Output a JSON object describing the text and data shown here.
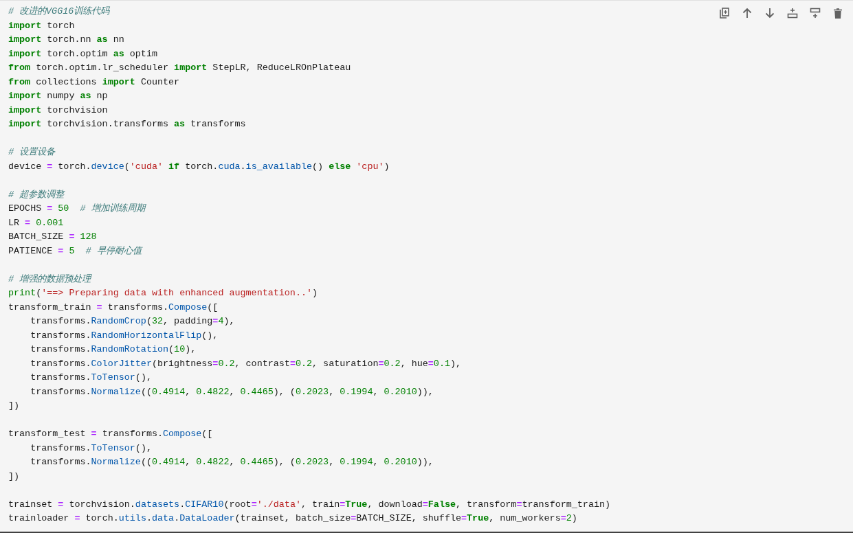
{
  "toolbar": [
    {
      "kind": "duplicate"
    },
    {
      "kind": "move-up"
    },
    {
      "kind": "move-down"
    },
    {
      "kind": "insert-above"
    },
    {
      "kind": "insert-below"
    },
    {
      "kind": "delete"
    }
  ],
  "lines": [
    {
      "kind": "code",
      "tokens": [
        {
          "kind": "comment",
          "text": "# 改进的VGG16训练代码"
        }
      ]
    },
    {
      "kind": "code",
      "tokens": [
        {
          "kind": "keyword",
          "text": "import"
        },
        {
          "kind": "plain",
          "text": " torch"
        }
      ]
    },
    {
      "kind": "code",
      "tokens": [
        {
          "kind": "keyword",
          "text": "import"
        },
        {
          "kind": "plain",
          "text": " torch.nn "
        },
        {
          "kind": "keyword",
          "text": "as"
        },
        {
          "kind": "plain",
          "text": " nn"
        }
      ]
    },
    {
      "kind": "code",
      "tokens": [
        {
          "kind": "keyword",
          "text": "import"
        },
        {
          "kind": "plain",
          "text": " torch.optim "
        },
        {
          "kind": "keyword",
          "text": "as"
        },
        {
          "kind": "plain",
          "text": " optim"
        }
      ]
    },
    {
      "kind": "code",
      "tokens": [
        {
          "kind": "keyword",
          "text": "from"
        },
        {
          "kind": "plain",
          "text": " torch.optim.lr_scheduler "
        },
        {
          "kind": "keyword",
          "text": "import"
        },
        {
          "kind": "plain",
          "text": " StepLR, ReduceLROnPlateau"
        }
      ]
    },
    {
      "kind": "code",
      "tokens": [
        {
          "kind": "keyword",
          "text": "from"
        },
        {
          "kind": "plain",
          "text": " collections "
        },
        {
          "kind": "keyword",
          "text": "import"
        },
        {
          "kind": "plain",
          "text": " Counter"
        }
      ]
    },
    {
      "kind": "code",
      "tokens": [
        {
          "kind": "keyword",
          "text": "import"
        },
        {
          "kind": "plain",
          "text": " numpy "
        },
        {
          "kind": "keyword",
          "text": "as"
        },
        {
          "kind": "plain",
          "text": " np"
        }
      ]
    },
    {
      "kind": "code",
      "tokens": [
        {
          "kind": "keyword",
          "text": "import"
        },
        {
          "kind": "plain",
          "text": " torchvision"
        }
      ]
    },
    {
      "kind": "code",
      "tokens": [
        {
          "kind": "keyword",
          "text": "import"
        },
        {
          "kind": "plain",
          "text": " torchvision.transforms "
        },
        {
          "kind": "keyword",
          "text": "as"
        },
        {
          "kind": "plain",
          "text": " transforms"
        }
      ]
    },
    {
      "kind": "blank"
    },
    {
      "kind": "code",
      "tokens": [
        {
          "kind": "comment",
          "text": "# 设置设备"
        }
      ]
    },
    {
      "kind": "code",
      "tokens": [
        {
          "kind": "plain",
          "text": "device "
        },
        {
          "kind": "operator",
          "text": "="
        },
        {
          "kind": "plain",
          "text": " torch."
        },
        {
          "kind": "property",
          "text": "device"
        },
        {
          "kind": "plain",
          "text": "("
        },
        {
          "kind": "string",
          "text": "'cuda'"
        },
        {
          "kind": "keyword",
          "text": " if"
        },
        {
          "kind": "plain",
          "text": " torch."
        },
        {
          "kind": "property",
          "text": "cuda"
        },
        {
          "kind": "plain",
          "text": "."
        },
        {
          "kind": "property",
          "text": "is_available"
        },
        {
          "kind": "plain",
          "text": "() "
        },
        {
          "kind": "keyword",
          "text": "else"
        },
        {
          "kind": "string",
          "text": " 'cpu'"
        },
        {
          "kind": "plain",
          "text": ")"
        }
      ]
    },
    {
      "kind": "blank"
    },
    {
      "kind": "code",
      "tokens": [
        {
          "kind": "comment",
          "text": "# 超参数调整"
        }
      ]
    },
    {
      "kind": "code",
      "tokens": [
        {
          "kind": "plain",
          "text": "EPOCHS "
        },
        {
          "kind": "operator",
          "text": "="
        },
        {
          "kind": "number",
          "text": " 50"
        },
        {
          "kind": "comment",
          "text": "  # 增加训练周期"
        }
      ]
    },
    {
      "kind": "code",
      "tokens": [
        {
          "kind": "plain",
          "text": "LR "
        },
        {
          "kind": "operator",
          "text": "="
        },
        {
          "kind": "number",
          "text": " 0.001"
        }
      ]
    },
    {
      "kind": "code",
      "tokens": [
        {
          "kind": "plain",
          "text": "BATCH_SIZE "
        },
        {
          "kind": "operator",
          "text": "="
        },
        {
          "kind": "number",
          "text": " 128"
        }
      ]
    },
    {
      "kind": "code",
      "tokens": [
        {
          "kind": "plain",
          "text": "PATIENCE "
        },
        {
          "kind": "operator",
          "text": "="
        },
        {
          "kind": "number",
          "text": " 5"
        },
        {
          "kind": "comment",
          "text": "  # 早停耐心值"
        }
      ]
    },
    {
      "kind": "blank"
    },
    {
      "kind": "code",
      "tokens": [
        {
          "kind": "comment",
          "text": "# 增强的数据预处理"
        }
      ]
    },
    {
      "kind": "code",
      "tokens": [
        {
          "kind": "builtin",
          "text": "print"
        },
        {
          "kind": "plain",
          "text": "("
        },
        {
          "kind": "string",
          "text": "'==> Preparing data with enhanced augmentation..'"
        },
        {
          "kind": "plain",
          "text": ")"
        }
      ]
    },
    {
      "kind": "code",
      "tokens": [
        {
          "kind": "plain",
          "text": "transform_train "
        },
        {
          "kind": "operator",
          "text": "="
        },
        {
          "kind": "plain",
          "text": " transforms."
        },
        {
          "kind": "property",
          "text": "Compose"
        },
        {
          "kind": "plain",
          "text": "(["
        }
      ]
    },
    {
      "kind": "code",
      "tokens": [
        {
          "kind": "plain",
          "text": "    transforms."
        },
        {
          "kind": "property",
          "text": "RandomCrop"
        },
        {
          "kind": "plain",
          "text": "("
        },
        {
          "kind": "number",
          "text": "32"
        },
        {
          "kind": "plain",
          "text": ", padding"
        },
        {
          "kind": "operator",
          "text": "="
        },
        {
          "kind": "number",
          "text": "4"
        },
        {
          "kind": "plain",
          "text": "),"
        }
      ]
    },
    {
      "kind": "code",
      "tokens": [
        {
          "kind": "plain",
          "text": "    transforms."
        },
        {
          "kind": "property",
          "text": "RandomHorizontalFlip"
        },
        {
          "kind": "plain",
          "text": "(),"
        }
      ]
    },
    {
      "kind": "code",
      "tokens": [
        {
          "kind": "plain",
          "text": "    transforms."
        },
        {
          "kind": "property",
          "text": "RandomRotation"
        },
        {
          "kind": "plain",
          "text": "("
        },
        {
          "kind": "number",
          "text": "10"
        },
        {
          "kind": "plain",
          "text": "),"
        }
      ]
    },
    {
      "kind": "code",
      "tokens": [
        {
          "kind": "plain",
          "text": "    transforms."
        },
        {
          "kind": "property",
          "text": "ColorJitter"
        },
        {
          "kind": "plain",
          "text": "(brightness"
        },
        {
          "kind": "operator",
          "text": "="
        },
        {
          "kind": "number",
          "text": "0.2"
        },
        {
          "kind": "plain",
          "text": ", contrast"
        },
        {
          "kind": "operator",
          "text": "="
        },
        {
          "kind": "number",
          "text": "0.2"
        },
        {
          "kind": "plain",
          "text": ", saturation"
        },
        {
          "kind": "operator",
          "text": "="
        },
        {
          "kind": "number",
          "text": "0.2"
        },
        {
          "kind": "plain",
          "text": ", hue"
        },
        {
          "kind": "operator",
          "text": "="
        },
        {
          "kind": "number",
          "text": "0.1"
        },
        {
          "kind": "plain",
          "text": "),"
        }
      ]
    },
    {
      "kind": "code",
      "tokens": [
        {
          "kind": "plain",
          "text": "    transforms."
        },
        {
          "kind": "property",
          "text": "ToTensor"
        },
        {
          "kind": "plain",
          "text": "(),"
        }
      ]
    },
    {
      "kind": "code",
      "tokens": [
        {
          "kind": "plain",
          "text": "    transforms."
        },
        {
          "kind": "property",
          "text": "Normalize"
        },
        {
          "kind": "plain",
          "text": "(("
        },
        {
          "kind": "number",
          "text": "0.4914"
        },
        {
          "kind": "plain",
          "text": ", "
        },
        {
          "kind": "number",
          "text": "0.4822"
        },
        {
          "kind": "plain",
          "text": ", "
        },
        {
          "kind": "number",
          "text": "0.4465"
        },
        {
          "kind": "plain",
          "text": "), ("
        },
        {
          "kind": "number",
          "text": "0.2023"
        },
        {
          "kind": "plain",
          "text": ", "
        },
        {
          "kind": "number",
          "text": "0.1994"
        },
        {
          "kind": "plain",
          "text": ", "
        },
        {
          "kind": "number",
          "text": "0.2010"
        },
        {
          "kind": "plain",
          "text": ")),"
        }
      ]
    },
    {
      "kind": "code",
      "tokens": [
        {
          "kind": "plain",
          "text": "])"
        }
      ]
    },
    {
      "kind": "blank"
    },
    {
      "kind": "code",
      "tokens": [
        {
          "kind": "plain",
          "text": "transform_test "
        },
        {
          "kind": "operator",
          "text": "="
        },
        {
          "kind": "plain",
          "text": " transforms."
        },
        {
          "kind": "property",
          "text": "Compose"
        },
        {
          "kind": "plain",
          "text": "(["
        }
      ]
    },
    {
      "kind": "code",
      "tokens": [
        {
          "kind": "plain",
          "text": "    transforms."
        },
        {
          "kind": "property",
          "text": "ToTensor"
        },
        {
          "kind": "plain",
          "text": "(),"
        }
      ]
    },
    {
      "kind": "code",
      "tokens": [
        {
          "kind": "plain",
          "text": "    transforms."
        },
        {
          "kind": "property",
          "text": "Normalize"
        },
        {
          "kind": "plain",
          "text": "(("
        },
        {
          "kind": "number",
          "text": "0.4914"
        },
        {
          "kind": "plain",
          "text": ", "
        },
        {
          "kind": "number",
          "text": "0.4822"
        },
        {
          "kind": "plain",
          "text": ", "
        },
        {
          "kind": "number",
          "text": "0.4465"
        },
        {
          "kind": "plain",
          "text": "), ("
        },
        {
          "kind": "number",
          "text": "0.2023"
        },
        {
          "kind": "plain",
          "text": ", "
        },
        {
          "kind": "number",
          "text": "0.1994"
        },
        {
          "kind": "plain",
          "text": ", "
        },
        {
          "kind": "number",
          "text": "0.2010"
        },
        {
          "kind": "plain",
          "text": ")),"
        }
      ]
    },
    {
      "kind": "code",
      "tokens": [
        {
          "kind": "plain",
          "text": "])"
        }
      ]
    },
    {
      "kind": "blank"
    },
    {
      "kind": "code",
      "tokens": [
        {
          "kind": "plain",
          "text": "trainset "
        },
        {
          "kind": "operator",
          "text": "="
        },
        {
          "kind": "plain",
          "text": " torchvision."
        },
        {
          "kind": "property",
          "text": "datasets"
        },
        {
          "kind": "plain",
          "text": "."
        },
        {
          "kind": "property",
          "text": "CIFAR10"
        },
        {
          "kind": "plain",
          "text": "(root"
        },
        {
          "kind": "operator",
          "text": "="
        },
        {
          "kind": "string",
          "text": "'./data'"
        },
        {
          "kind": "plain",
          "text": ", train"
        },
        {
          "kind": "operator",
          "text": "="
        },
        {
          "kind": "keyword",
          "text": "True"
        },
        {
          "kind": "plain",
          "text": ", download"
        },
        {
          "kind": "operator",
          "text": "="
        },
        {
          "kind": "keyword",
          "text": "False"
        },
        {
          "kind": "plain",
          "text": ", transform"
        },
        {
          "kind": "operator",
          "text": "="
        },
        {
          "kind": "plain",
          "text": "transform_train)"
        }
      ]
    },
    {
      "kind": "code",
      "tokens": [
        {
          "kind": "plain",
          "text": "trainloader "
        },
        {
          "kind": "operator",
          "text": "="
        },
        {
          "kind": "plain",
          "text": " torch."
        },
        {
          "kind": "property",
          "text": "utils"
        },
        {
          "kind": "plain",
          "text": "."
        },
        {
          "kind": "property",
          "text": "data"
        },
        {
          "kind": "plain",
          "text": "."
        },
        {
          "kind": "property",
          "text": "DataLoader"
        },
        {
          "kind": "plain",
          "text": "(trainset, batch_size"
        },
        {
          "kind": "operator",
          "text": "="
        },
        {
          "kind": "plain",
          "text": "BATCH_SIZE, shuffle"
        },
        {
          "kind": "operator",
          "text": "="
        },
        {
          "kind": "keyword",
          "text": "True"
        },
        {
          "kind": "plain",
          "text": ", num_workers"
        },
        {
          "kind": "operator",
          "text": "="
        },
        {
          "kind": "number",
          "text": "2"
        },
        {
          "kind": "plain",
          "text": ")"
        }
      ]
    }
  ]
}
